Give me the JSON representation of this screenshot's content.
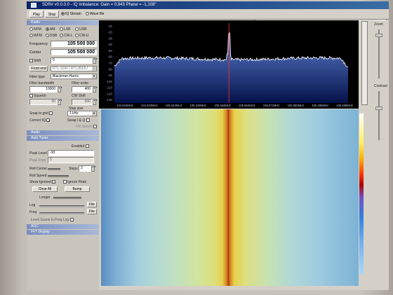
{
  "window": {
    "title": "SDR# v0.0.0.0 - IQ Imbalance: Gain = 0,943 Phase = -1,108°"
  },
  "toolbar": {
    "play_label": "Play",
    "stop_label": "Stop",
    "iq_stream_label": "IQ Stream",
    "wave_file_label": "Wave file"
  },
  "radio": {
    "header": "Radio",
    "modes_row1": [
      "NFM",
      "AM",
      "LSB",
      "USB"
    ],
    "modes_row2": [
      "WFM",
      "DSB",
      "CW-L",
      "CW-U"
    ],
    "selected_mode": "AM",
    "frequency_label": "Frequency",
    "frequency_value": "105 500 000",
    "center_label": "Center",
    "center_value": "105 500 000",
    "shift_label": "Shift",
    "shift_value": "0",
    "front_end_button": "Front end",
    "device_value": "RTL-SDR / RTL2832U",
    "filter_type_label": "Filter type",
    "filter_type_value": "Blackman-Harris",
    "filter_bandwidth_label": "Filter bandwidth",
    "filter_bandwidth_value": "10000",
    "filter_order_label": "Filter order",
    "filter_order_value": "400",
    "squelch_label": "Squelch",
    "cw_shift_label": "CW Shift",
    "squelch_value": "50",
    "cw_shift_value": "600",
    "step_size_label": "Step size",
    "snap_label": "Snap to grid",
    "step_value": "1 kHz",
    "correct_iq_label": "Correct IQ",
    "swap_iq_label": "Swap I & Q",
    "fm_stereo_label": "FM Stereo"
  },
  "audio": {
    "header": "Audio"
  },
  "auto_tuner": {
    "header": "Auto Tuner",
    "enabled_label": "Enabled",
    "peak_level_label": "Peak Level",
    "peak_level_value": "-30",
    "peak_freq_label": "Peak Freq",
    "peak_freq_value": "0",
    "roll_center_label": "Roll Center",
    "steps_label": "Steps",
    "steps_value": "2",
    "roll_speed_label": "Roll Speed",
    "show_ignored_label": "Show Ignored",
    "ignore_peak_label": "Ignore Peak",
    "clear_all_button": "Clear All",
    "bump_button": "Bump",
    "longer_label": "Longer",
    "log_label": "Log",
    "file_button": "File",
    "freq_label": "Freq",
    "freq_file_button": "File",
    "level_scans_label": "Level Scans to Freq Log"
  },
  "agc": {
    "header": "AGC"
  },
  "fft": {
    "header": "FFT Display"
  },
  "right": {
    "zoom_label": "Zoom",
    "contrast_label": "Contrast"
  },
  "chart_data": {
    "type": "area",
    "y_ticks": [
      "-10",
      "-20",
      "-30",
      "-40",
      "-50",
      "-60",
      "-70",
      "-80",
      "-90",
      "-100",
      "-110",
      "-120",
      "-130"
    ],
    "x_ticks": [
      "104.824MHz",
      "104.032MHz",
      "105.042MHz",
      "105.248MHz",
      "105.464MHz",
      "105.664MHz",
      "105.872MHz",
      "106.080MHz",
      "106.288MHz",
      "106.488MHz"
    ],
    "ylim": [
      -135,
      -5
    ],
    "noise_floor_db": -63,
    "peak_db": -22,
    "peak_x_fraction": 0.49,
    "colors": {
      "trace": "#ffffff",
      "fill_top": "#5d7fd0",
      "fill_bottom": "#05124a",
      "marker": "#ff3030"
    }
  }
}
